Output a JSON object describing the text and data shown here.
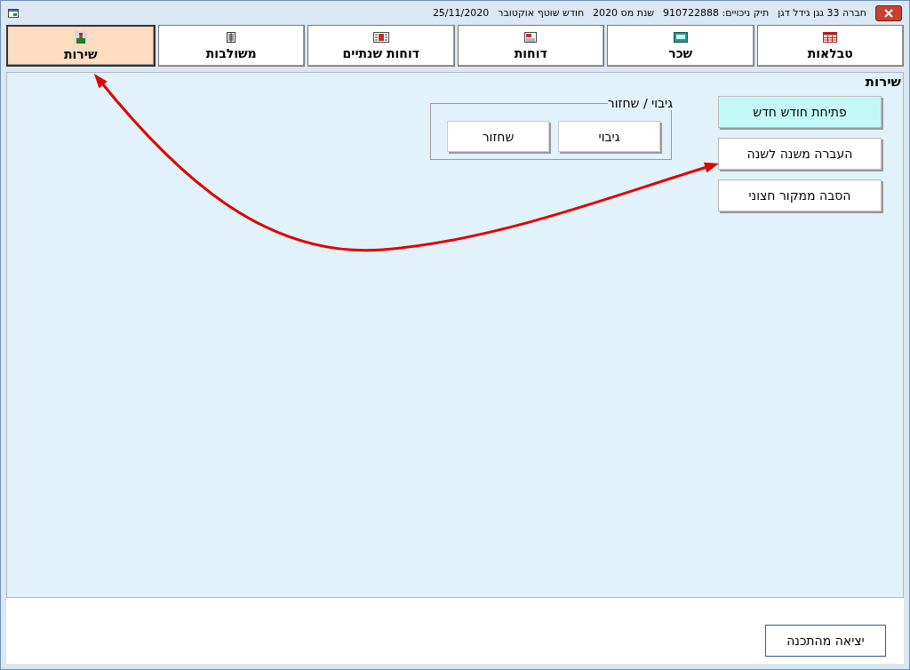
{
  "window": {
    "title_parts": [
      "חברה 33 גגן גידל דגן",
      "תיק ניכויים: 910722888",
      "שנת מס 2020",
      "חודש שוטף אוקטובר",
      "25/11/2020"
    ]
  },
  "tabs": [
    {
      "label": "טבלאות",
      "selected": false
    },
    {
      "label": "שכר",
      "selected": false
    },
    {
      "label": "דוחות",
      "selected": false
    },
    {
      "label": "דוחות שנתיים",
      "selected": false
    },
    {
      "label": "משולבות",
      "selected": false
    },
    {
      "label": "שירות",
      "selected": true
    }
  ],
  "panel": {
    "title": "שירות",
    "actions": [
      {
        "label": "פתיחת חודש חדש",
        "focused": true
      },
      {
        "label": "העברה משנה לשנה",
        "focused": false
      },
      {
        "label": "הסבה ממקור חצוני",
        "focused": false
      }
    ],
    "backup_group": {
      "title": "גיבוי / שחזור",
      "buttons": [
        "גיבוי",
        "שחזור"
      ]
    }
  },
  "exit_button": "יציאה מהתכנה"
}
